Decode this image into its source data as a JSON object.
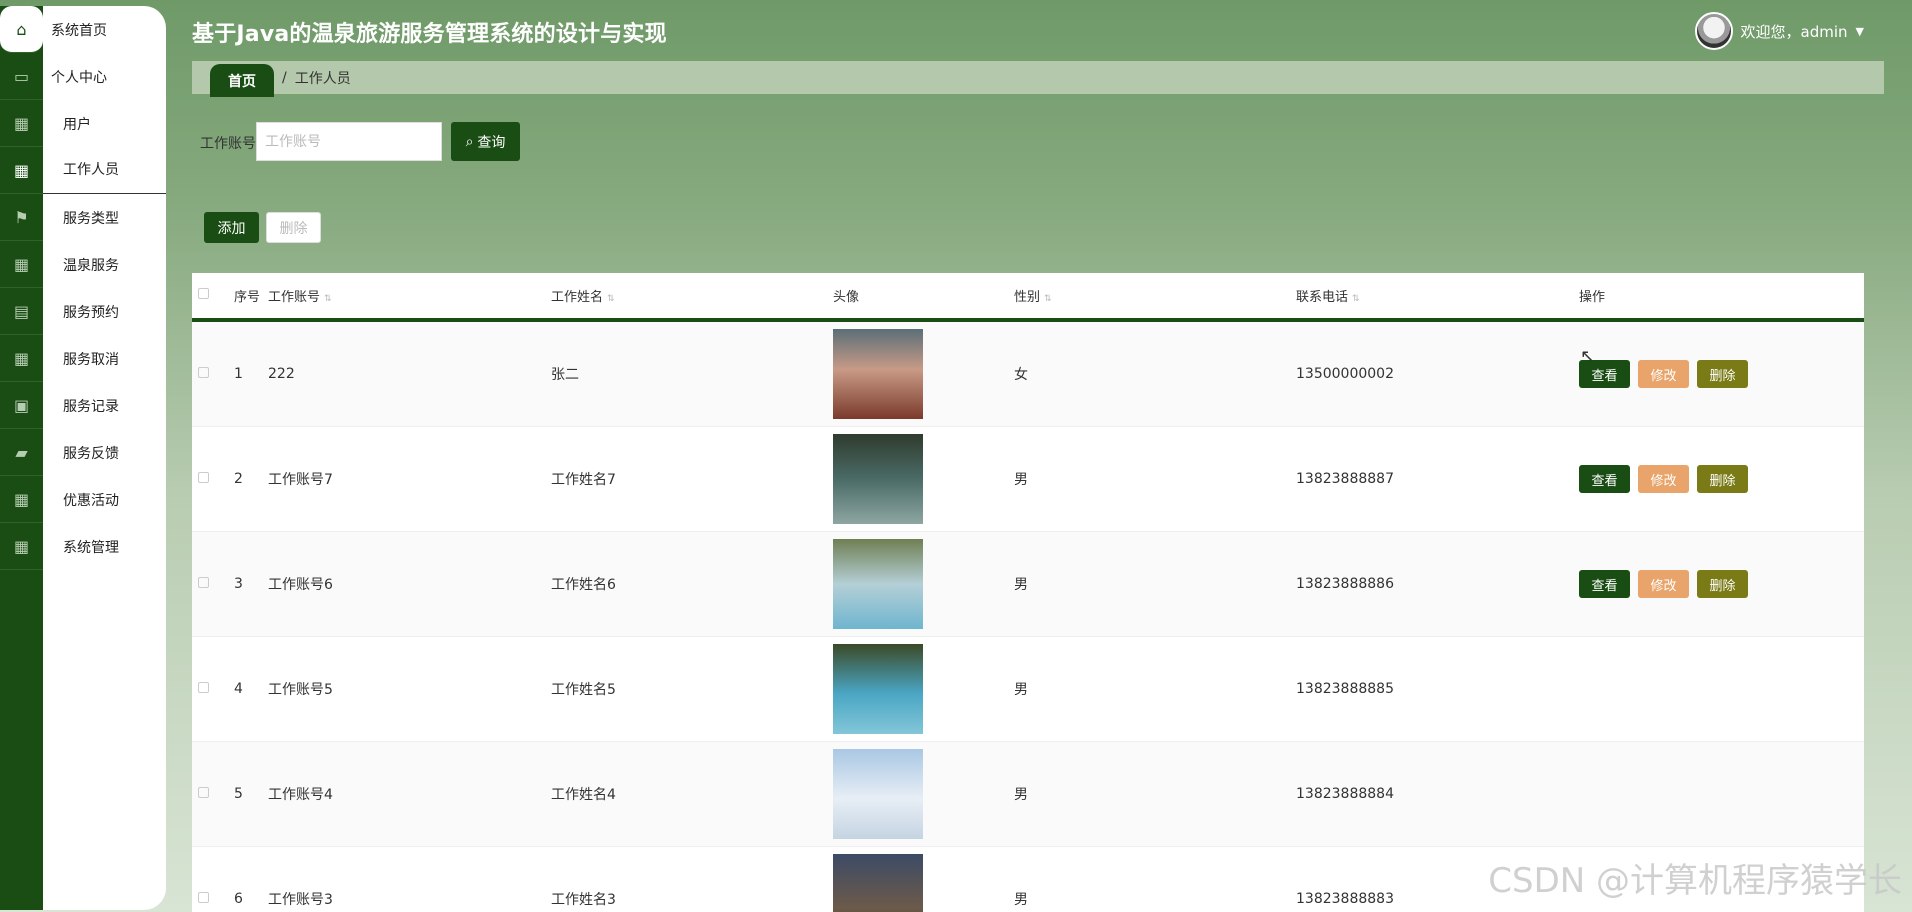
{
  "header": {
    "title": "基于Java的温泉旅游服务管理系统的设计与实现",
    "welcome": "欢迎您，admin"
  },
  "sidebar": {
    "items": [
      {
        "label": "系统首页",
        "icon": "home-icon"
      },
      {
        "label": "个人中心",
        "icon": "wallet-icon"
      },
      {
        "label": "用户",
        "icon": "grid-icon"
      },
      {
        "label": "工作人员",
        "icon": "grid-icon"
      },
      {
        "label": "服务类型",
        "icon": "flag-icon"
      },
      {
        "label": "温泉服务",
        "icon": "grid-icon"
      },
      {
        "label": "服务预约",
        "icon": "clipboard-icon"
      },
      {
        "label": "服务取消",
        "icon": "grid-icon"
      },
      {
        "label": "服务记录",
        "icon": "tray-icon"
      },
      {
        "label": "服务反馈",
        "icon": "ticket-icon"
      },
      {
        "label": "优惠活动",
        "icon": "grid-icon"
      },
      {
        "label": "系统管理",
        "icon": "grid-icon"
      }
    ]
  },
  "breadcrumb": {
    "home": "首页",
    "sep": "/",
    "current": "工作人员"
  },
  "search": {
    "label": "工作账号",
    "placeholder": "工作账号",
    "button": "查询"
  },
  "actions": {
    "add": "添加",
    "delete": "删除"
  },
  "table": {
    "headers": [
      "序号",
      "工作账号",
      "工作姓名",
      "头像",
      "性别",
      "联系电话",
      "操作"
    ],
    "rows": [
      {
        "idx": "1",
        "account": "222",
        "name": "张二",
        "gender": "女",
        "phone": "13500000002",
        "img": "portrait"
      },
      {
        "idx": "2",
        "account": "工作账号7",
        "name": "工作姓名7",
        "gender": "男",
        "phone": "13823888887",
        "img": "pool-lilies"
      },
      {
        "idx": "3",
        "account": "工作账号6",
        "name": "工作姓名6",
        "gender": "男",
        "phone": "13823888886",
        "img": "hotspring-steam"
      },
      {
        "idx": "4",
        "account": "工作账号5",
        "name": "工作姓名5",
        "gender": "男",
        "phone": "13823888885",
        "img": "pool-blue"
      },
      {
        "idx": "5",
        "account": "工作账号4",
        "name": "工作姓名4",
        "gender": "男",
        "phone": "13823888884",
        "img": "snow-cabin"
      },
      {
        "idx": "6",
        "account": "工作账号3",
        "name": "工作姓名3",
        "gender": "男",
        "phone": "13823888883",
        "img": "evening-lodge"
      }
    ],
    "ops": {
      "view": "查看",
      "edit": "修改",
      "delete": "删除"
    }
  },
  "watermark": "CSDN @计算机程序猿学长",
  "colors": {
    "primary": "#1a4d14",
    "edit": "#e8a46a",
    "delete": "#7a7a16"
  }
}
